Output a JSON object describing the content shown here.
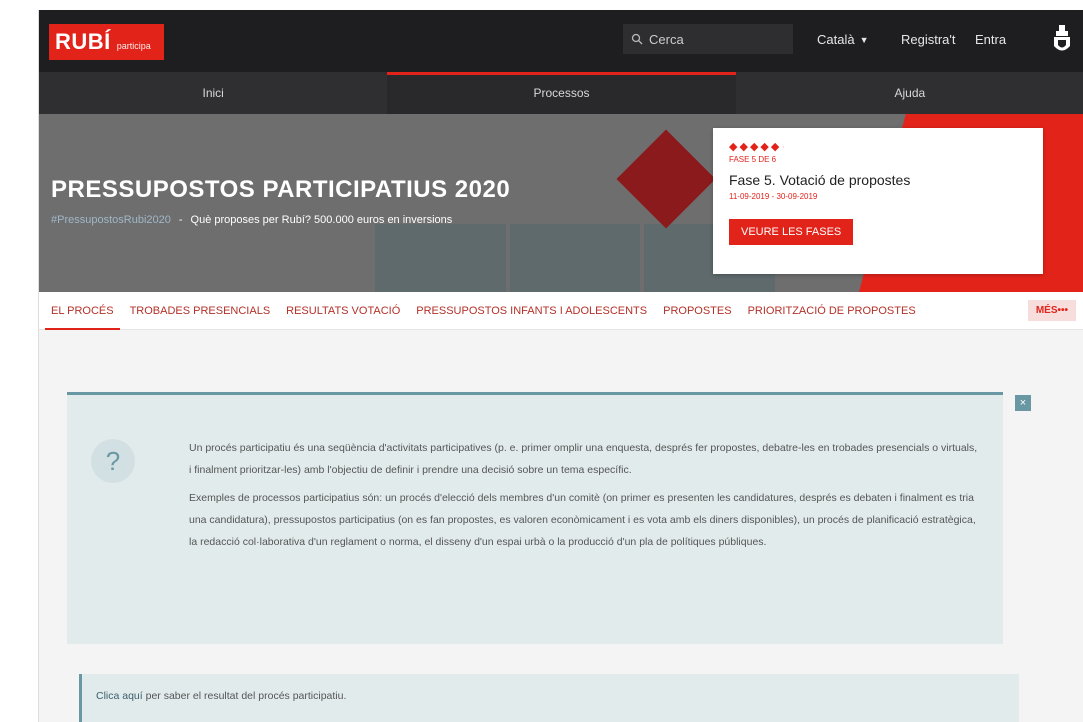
{
  "header": {
    "logo_main": "RUBÍ",
    "logo_sub": "participa",
    "search_placeholder": "Cerca",
    "language": "Català",
    "register": "Registra't",
    "login": "Entra"
  },
  "mainnav": {
    "items": [
      {
        "label": "Inici"
      },
      {
        "label": "Processos"
      },
      {
        "label": "Ajuda"
      }
    ],
    "active_index": 1
  },
  "hero": {
    "title": "PRESSUPOSTOS PARTICIPATIUS 2020",
    "hashtag": "#PressupostosRubi2020",
    "subtitle": "Què proposes per Rubí? 500.000 euros en inversions"
  },
  "phase_card": {
    "rating": 5,
    "phase_label": "FASE 5 DE 6",
    "phase_name": "Fase 5. Votació de propostes",
    "phase_dates": "11-09-2019 - 30-09-2019",
    "button": "VEURE LES FASES"
  },
  "tabs": {
    "items": [
      {
        "label": "EL PROCÉS"
      },
      {
        "label": "TROBADES PRESENCIALS"
      },
      {
        "label": "RESULTATS VOTACIÓ"
      },
      {
        "label": "PRESSUPOSTOS INFANTS I ADOLESCENTS"
      },
      {
        "label": "PROPOSTES"
      },
      {
        "label": "PRIORITZACIÓ DE PROPOSTES"
      }
    ],
    "more": "MÉS•••"
  },
  "callout": {
    "close": "×",
    "badge": "?",
    "paragraph1": "Un procés participatiu és una seqüència d'activitats participatives (p. e. primer omplir una enquesta, després fer propostes, debatre-les en trobades presencials o virtuals, i finalment prioritzar-les) amb l'objectiu de definir i prendre una decisió sobre un tema específic.",
    "paragraph2": "Exemples de processos participatius són: un procés d'elecció dels membres d'un comitè (on primer es presenten les candidatures, després es debaten i finalment es tria una candidatura), pressupostos participatius (on es fan propostes, es valoren econòmicament i es vota amb els diners disponibles), un procés de planificació estratègica, la redacció col·laborativa d'un reglament o norma, el disseny d'un espai urbà o la producció d'un pla de polítiques públiques."
  },
  "result": {
    "link": "Clica aquí",
    "text": " per saber el resultat del procés participatiu."
  },
  "colors": {
    "brand": "#e2231a",
    "topbar": "#1e1e20",
    "nav": "#2f2f32",
    "callout": "#e2ebec",
    "callout_accent": "#6a97a4"
  }
}
